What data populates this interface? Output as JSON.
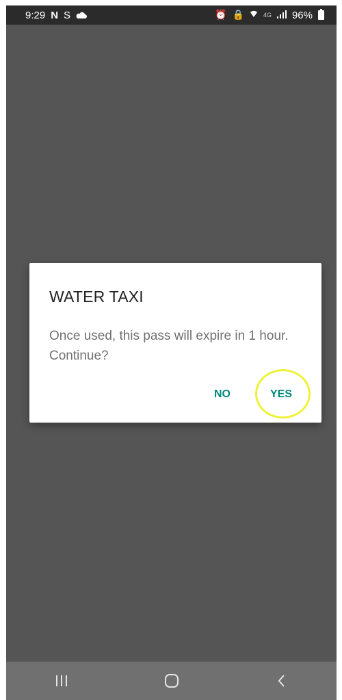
{
  "status_bar": {
    "time": "9:29",
    "left_icons": [
      "N",
      "S"
    ],
    "cloud_icon": "cloud-icon",
    "network_label": "4G",
    "battery": "96%"
  },
  "dialog": {
    "title": "WATER TAXI",
    "message": "Once used, this pass will expire in 1 hour. Continue?",
    "no_label": "NO",
    "yes_label": "YES"
  },
  "nav_bar": {
    "recent_icon": "recent-apps-icon",
    "home_icon": "home-icon",
    "back_icon": "back-icon"
  },
  "colors": {
    "accent": "#00897b",
    "highlight": "#eef234",
    "scrim": "#555555"
  }
}
